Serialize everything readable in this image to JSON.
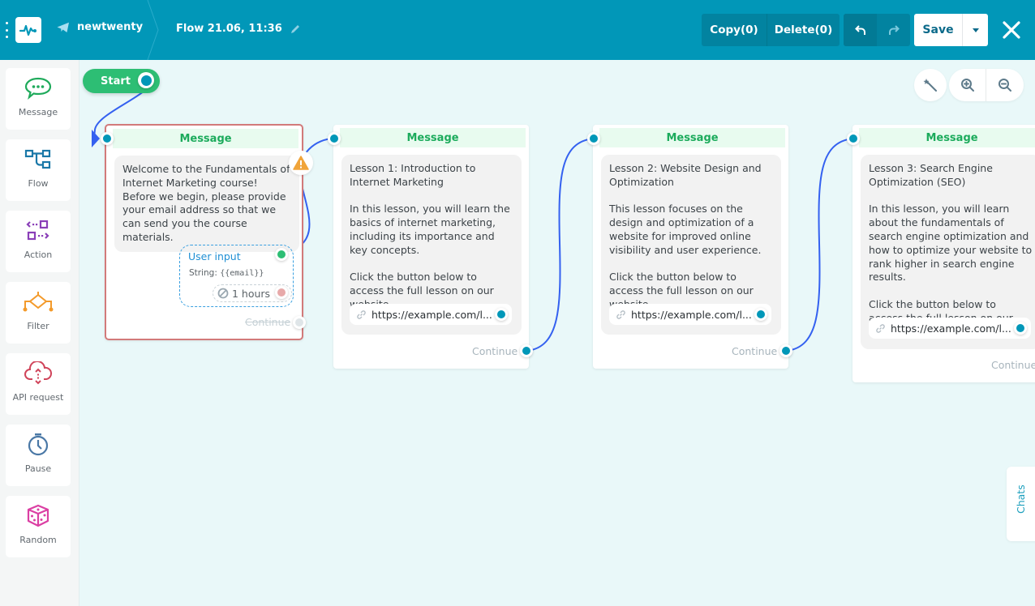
{
  "header": {
    "bot_name": "newtwenty",
    "flow_title": "Flow 21.06, 11:36",
    "copy_label": "Copy(0)",
    "delete_label": "Delete(0)",
    "save_label": "Save"
  },
  "sidebar": {
    "items": [
      {
        "label": "Message",
        "icon": "chat-bubble-icon",
        "color": "#1faa5b"
      },
      {
        "label": "Flow",
        "icon": "flow-icon",
        "color": "#1a78a8"
      },
      {
        "label": "Action",
        "icon": "action-icon",
        "color": "#8a3fb8"
      },
      {
        "label": "Filter",
        "icon": "filter-icon",
        "color": "#f39a2b"
      },
      {
        "label": "API request",
        "icon": "cloud-icon",
        "color": "#d0445a"
      },
      {
        "label": "Pause",
        "icon": "stopwatch-icon",
        "color": "#4a78a6"
      },
      {
        "label": "Random",
        "icon": "dice-icon",
        "color": "#db3fa3"
      }
    ]
  },
  "canvas": {
    "start_label": "Start",
    "nodes": [
      {
        "title": "Message",
        "text": "Welcome to the Fundamentals of Internet Marketing course! Before we begin, please provide your email address so that we can send you the course materials.",
        "user_input": {
          "label": "User input",
          "type_prefix": "String:",
          "variable": "{{email}}",
          "timeout": "1 hours"
        },
        "continue_label": "Continue",
        "warning": true
      },
      {
        "title": "Message",
        "text": "Lesson 1: Introduction to Internet Marketing\n\nIn this lesson, you will learn the basics of internet marketing, including its importance and key concepts.\n\nClick the button below to access the full lesson on our website.",
        "link": "https://example.com/l...",
        "continue_label": "Continue"
      },
      {
        "title": "Message",
        "text": "Lesson 2: Website Design and Optimization\n\nThis lesson focuses on the design and optimization of a website for improved online visibility and user experience.\n\nClick the button below to access the full lesson on our website.",
        "link": "https://example.com/l...",
        "continue_label": "Continue"
      },
      {
        "title": "Message",
        "text": "Lesson 3: Search Engine Optimization (SEO)\n\nIn this lesson, you will learn about the fundamentals of search engine optimization and how to optimize your website to rank higher in search engine results.\n\nClick the button below to access the full lesson on our website.",
        "link": "https://example.com/l...",
        "continue_label": "Continue"
      }
    ]
  },
  "chats_tab": "Chats",
  "colors": {
    "header": "#0197b8",
    "accent_green": "#2dbe74",
    "wire": "#3461f0",
    "error_border": "#d27a7a"
  }
}
